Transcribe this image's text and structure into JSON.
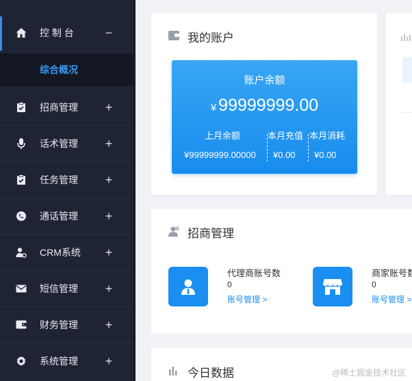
{
  "sidebar": {
    "items": [
      {
        "label": "控 制 台",
        "sign": "−",
        "icon": "home-icon",
        "sub": {
          "label": "综合概况"
        }
      },
      {
        "label": "招商管理",
        "sign": "+",
        "icon": "clipboard-icon"
      },
      {
        "label": "话术管理",
        "sign": "+",
        "icon": "microphone-icon"
      },
      {
        "label": "任务管理",
        "sign": "+",
        "icon": "clipboard-check-icon"
      },
      {
        "label": "通话管理",
        "sign": "+",
        "icon": "phone-circle-icon"
      },
      {
        "label": "CRM系统",
        "sign": "+",
        "icon": "user-settings-icon"
      },
      {
        "label": "短信管理",
        "sign": "+",
        "icon": "mail-icon"
      },
      {
        "label": "财务管理",
        "sign": "+",
        "icon": "wallet-icon"
      },
      {
        "label": "系统管理",
        "sign": "+",
        "icon": "gear-icon"
      }
    ]
  },
  "account": {
    "title": "我的账户",
    "balance_title": "账户余额",
    "currency": "¥",
    "balance": "99999999.00",
    "last_month_label": "上月余额",
    "last_month_value": "¥99999999.00000",
    "recharge_label": "本月充值",
    "recharge_value": "¥0.00",
    "consume_label": "本月消耗",
    "consume_value": "¥0.00"
  },
  "merchant": {
    "title": "招商管理",
    "stats": [
      {
        "label": "代理商账号数",
        "value": "0",
        "link": "账号管理 >",
        "icon": "agent-user-icon"
      },
      {
        "label": "商家账号数",
        "value": "0",
        "link": "账号管理 >",
        "icon": "store-icon"
      }
    ]
  },
  "today": {
    "title": "今日数据"
  },
  "watermark": "@稀土掘金技术社区",
  "colors": {
    "sidebar_bg": "#1e2433",
    "accent": "#1b8ef2",
    "submenu_text": "#3a98f2",
    "page_bg": "#f0f2f5"
  }
}
